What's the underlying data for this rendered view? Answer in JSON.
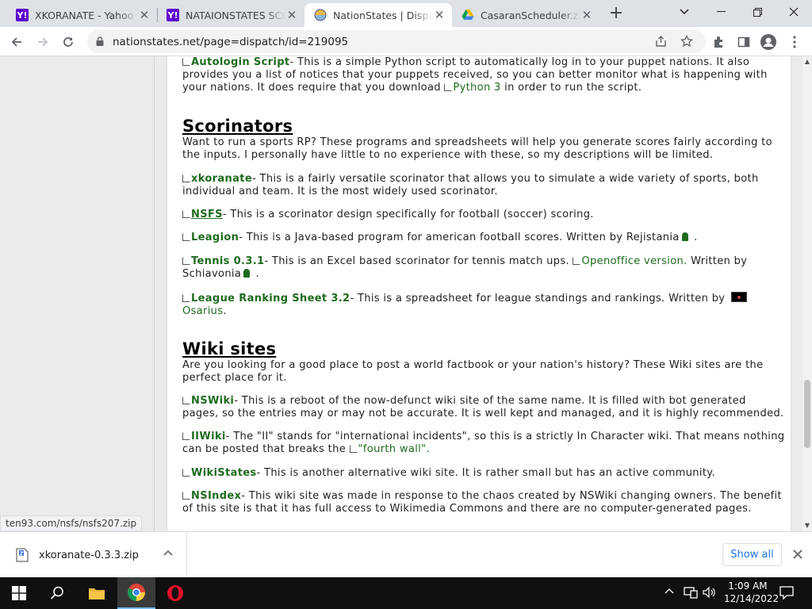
{
  "tabs": [
    {
      "title": "XKORANATE - Yahoo Se",
      "favicon": "yahoo-icon",
      "active": false
    },
    {
      "title": "NATAIONSTATES SCOR",
      "favicon": "yahoo-icon",
      "active": false
    },
    {
      "title": "NationStates | Dispatch",
      "favicon": "nationstates-icon",
      "active": true
    },
    {
      "title": "CasaranScheduler.zip -",
      "favicon": "google-drive-icon",
      "active": false
    }
  ],
  "toolbar": {
    "url": "nationstates.net/page=dispatch/id=219095"
  },
  "dispatch": {
    "autologin": {
      "link": "Autologin Script",
      "text": "- This is a simple Python script to automatically log in to your puppet nations. It also provides you a list of notices that your puppets received, so you can better monitor what is happening with your nations. It does require that you download ",
      "link2": "Python 3",
      "text2": " in order to run the script."
    },
    "scorinators": {
      "heading": "Scorinators",
      "intro": "Want to run a sports RP? These programs and spreadsheets will help you generate scores fairly according to the inputs. I personally have little to no experience with these, so my descriptions will be limited.",
      "items": [
        {
          "link": "xkoranate",
          "text": "- This is a fairly versatile scorinator that allows you to simulate a wide variety of sports, both individual and team. It is the most widely used scorinator."
        },
        {
          "link": "NSFS",
          "text": "- This is a scorinator design specifically for football (soccer) scoring."
        },
        {
          "link": "Leagion",
          "text": "- This is a Java-based program for american football scores. Written by Rejistania",
          "tail": " ."
        },
        {
          "link": "Tennis 0.3.1",
          "text": "- This is an Excel based scorinator for tennis match ups. ",
          "link2": "Openoffice version.",
          "text2": " Written by Schiavonia",
          "tail": " ."
        },
        {
          "link": "League Ranking Sheet 3.2",
          "text": "- This is a spreadsheet for league standings and rankings. Written by ",
          "link2": "Osarius",
          "tail": "."
        }
      ]
    },
    "wiki": {
      "heading": "Wiki sites",
      "intro": "Are you looking for a good place to post a world factbook or your nation's history? These Wiki sites are the perfect place for it.",
      "items": [
        {
          "link": "NSWiki",
          "text": "- This is a reboot of the now-defunct wiki site of the same name. It is filled with bot generated pages, so the entries may or may not be accurate. It is well kept and managed, and it is highly recommended."
        },
        {
          "link": "IIWiki",
          "text": "- The \"II\" stands for \"international incidents\", so this is a strictly In Character wiki. That means nothing can be posted that breaks the ",
          "link2": "\"fourth wall\".",
          "tail": ""
        },
        {
          "link": "WikiStates",
          "text": "- This is another alternative wiki site. It is rather small but has an active community."
        },
        {
          "link": "NSIndex",
          "text": "- This wiki site was made in response to the chaos created by NSWiki changing owners. The benefit of this site is that it has full access to Wikimedia Commons and there are no computer-generated pages."
        }
      ]
    }
  },
  "status_url": "ten93.com/nsfs/nsfs207.zip",
  "download": {
    "filename": "xkoranate-0.3.3.zip",
    "show_all": "Show all"
  },
  "taskbar": {
    "time": "1:09 AM",
    "date": "12/14/2022"
  }
}
